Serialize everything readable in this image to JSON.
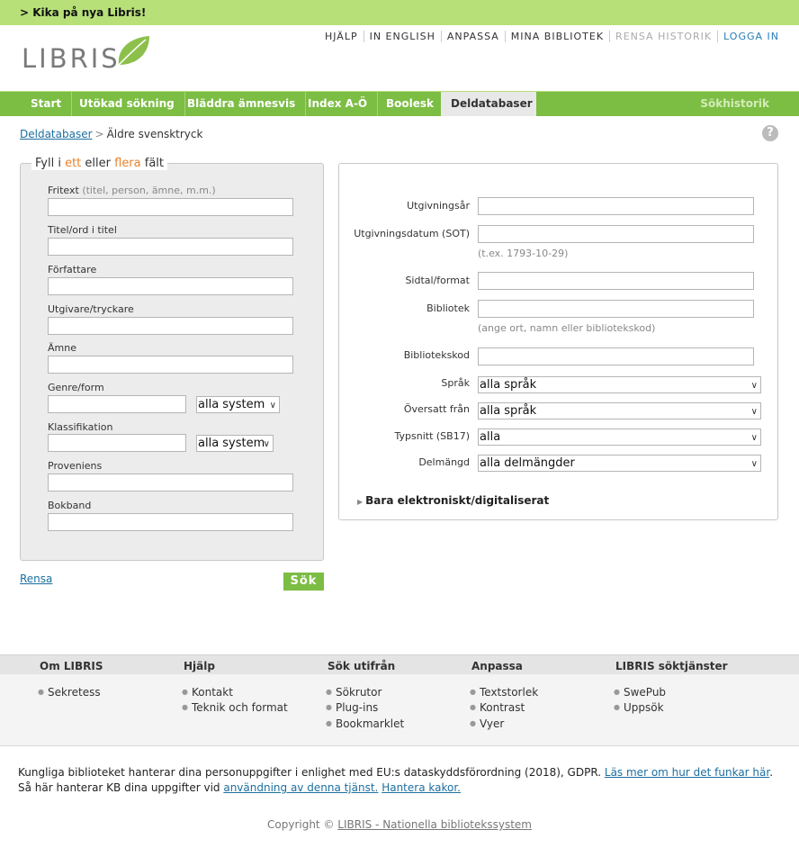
{
  "banner": {
    "text": "> Kika på nya Libris!"
  },
  "logo": {
    "text": "LIBRIS"
  },
  "toplinks": [
    "HJÄLP",
    "IN ENGLISH",
    "ANPASSA",
    "MINA BIBLIOTEK",
    "RENSA HISTORIK",
    "LOGGA IN"
  ],
  "nav": {
    "tabs": [
      "Start",
      "Utökad sökning",
      "Bläddra ämnesvis",
      "Index A-Ö",
      "Boolesk",
      "Deldatabaser"
    ],
    "history": "Sökhistorik"
  },
  "breadcrumb": {
    "link": "Deldatabaser",
    "sep": ">",
    "current": "Äldre svensktryck"
  },
  "help": {
    "glyph": "?"
  },
  "left": {
    "legend": {
      "a": "Fyll i ",
      "b": "ett",
      "c": " eller ",
      "d": "flera",
      "e": " fält"
    },
    "fritext_label": "Fritext",
    "fritext_hint": "(titel, person, ämne, m.m.)",
    "titel_label": "Titel/ord i titel",
    "forfattare_label": "Författare",
    "utgivare_label": "Utgivare/tryckare",
    "amne_label": "Ämne",
    "genre_label": "Genre/form",
    "genre_select": "alla system",
    "klass_label": "Klassifikation",
    "klass_select": "alla system",
    "proveniens_label": "Proveniens",
    "bokband_label": "Bokband"
  },
  "right": {
    "utgivningsar": "Utgivningsår",
    "utgivningsdatum": "Utgivningsdatum (SOT)",
    "datum_hint": "(t.ex. 1793-10-29)",
    "sidtal": "Sidtal/format",
    "bibliotek": "Bibliotek",
    "bibliotek_hint": "(ange ort, namn eller bibliotekskod)",
    "bibliotekskod": "Bibliotekskod",
    "sprak": "Språk",
    "sprak_select": "alla språk",
    "oversatt": "Översatt från",
    "oversatt_select": "alla språk",
    "typsnitt": "Typsnitt (SB17)",
    "typsnitt_select": "alla",
    "delmangd": "Delmängd",
    "delmangd_select": "alla delmängder",
    "disclosure": "Bara elektroniskt/digitaliserat"
  },
  "actions": {
    "rensa": "Rensa",
    "sok": "Sök"
  },
  "footer": {
    "cols": [
      {
        "title": "Om LIBRIS",
        "items": [
          "Sekretess"
        ]
      },
      {
        "title": "Hjälp",
        "items": [
          "Kontakt",
          "Teknik och format"
        ]
      },
      {
        "title": "Sök utifrån",
        "items": [
          "Sökrutor",
          "Plug-ins",
          "Bookmarklet"
        ]
      },
      {
        "title": "Anpassa",
        "items": [
          "Textstorlek",
          "Kontrast",
          "Vyer"
        ]
      },
      {
        "title": "LIBRIS söktjänster",
        "items": [
          "SwePub",
          "Uppsök"
        ]
      }
    ]
  },
  "privacy": {
    "line1": "Kungliga biblioteket hanterar dina personuppgifter i enlighet med EU:s dataskyddsförordning (2018), GDPR.",
    "line1_link": "Läs mer om hur det funkar här",
    "line2": "Så här hanterar KB dina uppgifter vid",
    "line2_link": "användning av denna tjänst.",
    "line2_link2": "Hantera kakor."
  },
  "copyright": {
    "prefix": "Copyright ©",
    "link": "LIBRIS - Nationella bibliotekssystem"
  },
  "colors": {
    "banner": "#b8e079",
    "nav": "#7cbd44",
    "accent_orange": "#e8822a",
    "link": "#1c6fa0"
  }
}
